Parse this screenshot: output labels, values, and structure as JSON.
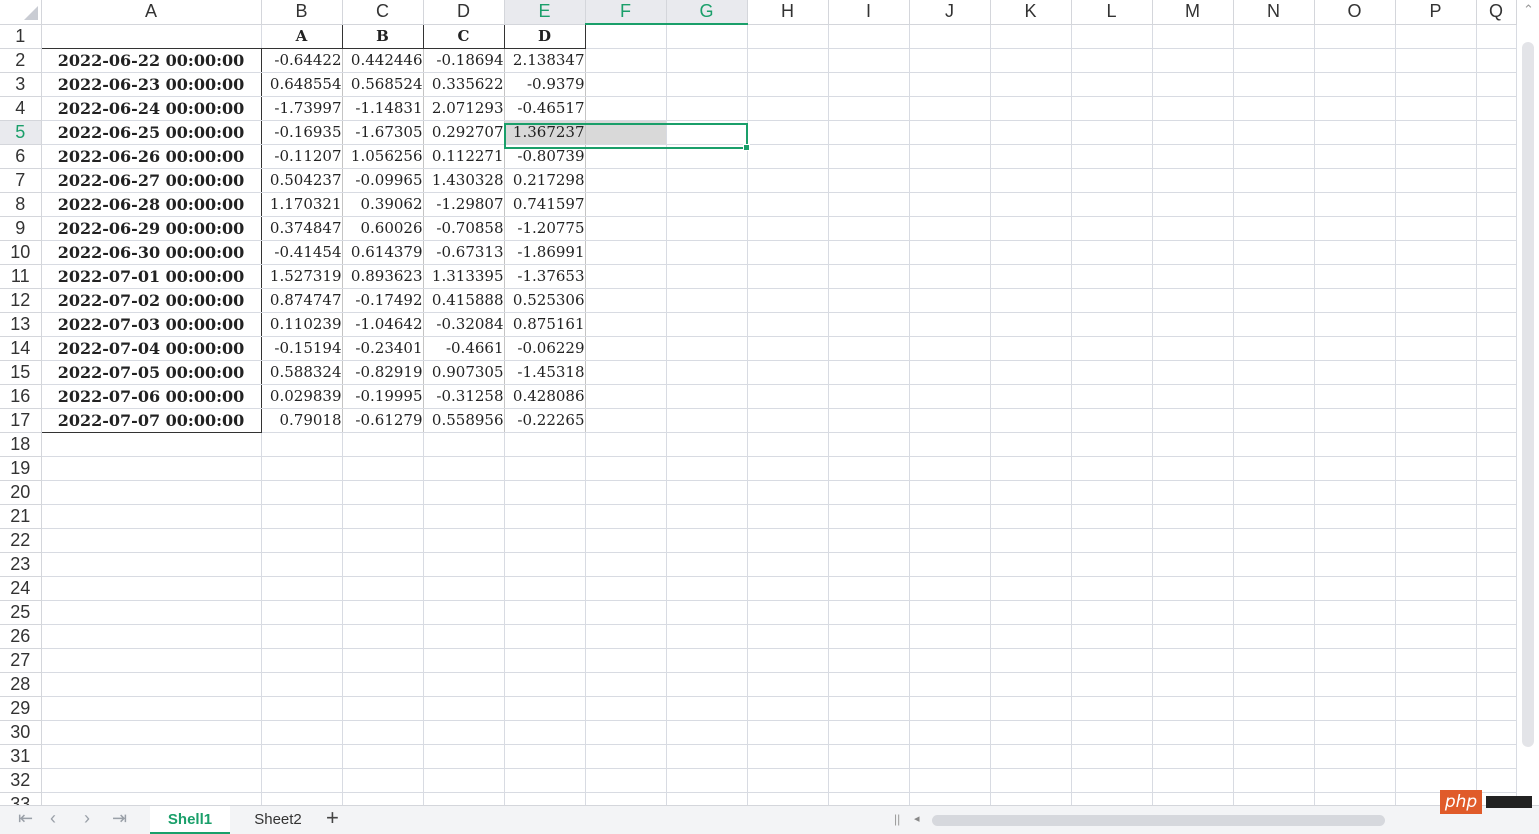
{
  "columns": [
    "A",
    "B",
    "C",
    "D",
    "E",
    "F",
    "G",
    "H",
    "I",
    "J",
    "K",
    "L",
    "M",
    "N",
    "O",
    "P",
    "Q"
  ],
  "row_count": 33,
  "header_row": [
    "",
    "A",
    "B",
    "C",
    "D"
  ],
  "rows": [
    [
      "2022-06-22 00:00:00",
      "-0.64422",
      "0.442446",
      "-0.18694",
      "2.138347"
    ],
    [
      "2022-06-23 00:00:00",
      "0.648554",
      "0.568524",
      "0.335622",
      "-0.9379"
    ],
    [
      "2022-06-24 00:00:00",
      "-1.73997",
      "-1.14831",
      "2.071293",
      "-0.46517"
    ],
    [
      "2022-06-25 00:00:00",
      "-0.16935",
      "-1.67305",
      "0.292707",
      "1.367237"
    ],
    [
      "2022-06-26 00:00:00",
      "-0.11207",
      "1.056256",
      "0.112271",
      "-0.80739"
    ],
    [
      "2022-06-27 00:00:00",
      "0.504237",
      "-0.09965",
      "1.430328",
      "0.217298"
    ],
    [
      "2022-06-28 00:00:00",
      "1.170321",
      "0.39062",
      "-1.29807",
      "0.741597"
    ],
    [
      "2022-06-29 00:00:00",
      "0.374847",
      "0.60026",
      "-0.70858",
      "-1.20775"
    ],
    [
      "2022-06-30 00:00:00",
      "-0.41454",
      "0.614379",
      "-0.67313",
      "-1.86991"
    ],
    [
      "2022-07-01 00:00:00",
      "1.527319",
      "0.893623",
      "1.313395",
      "-1.37653"
    ],
    [
      "2022-07-02 00:00:00",
      "0.874747",
      "-0.17492",
      "0.415888",
      "0.525306"
    ],
    [
      "2022-07-03 00:00:00",
      "0.110239",
      "-1.04642",
      "-0.32084",
      "0.875161"
    ],
    [
      "2022-07-04 00:00:00",
      "-0.15194",
      "-0.23401",
      "-0.4661",
      "-0.06229"
    ],
    [
      "2022-07-05 00:00:00",
      "0.588324",
      "-0.82919",
      "0.907305",
      "-1.45318"
    ],
    [
      "2022-07-06 00:00:00",
      "0.029839",
      "-0.19995",
      "-0.31258",
      "0.428086"
    ],
    [
      "2022-07-07 00:00:00",
      "0.79018",
      "-0.61279",
      "0.558956",
      "-0.22265"
    ]
  ],
  "selection": {
    "row": 5,
    "columns": [
      "E",
      "F",
      "G"
    ]
  },
  "tabs": {
    "active": "Shell1",
    "other": "Sheet2",
    "add": "+"
  },
  "nav": {
    "first": "|<",
    "prev": "<",
    "next": ">",
    "last": ">|"
  },
  "watermark": "php",
  "colors": {
    "accent": "#1a9f6a",
    "grid": "#d8dbe2",
    "fill": "#d9d9d9"
  }
}
